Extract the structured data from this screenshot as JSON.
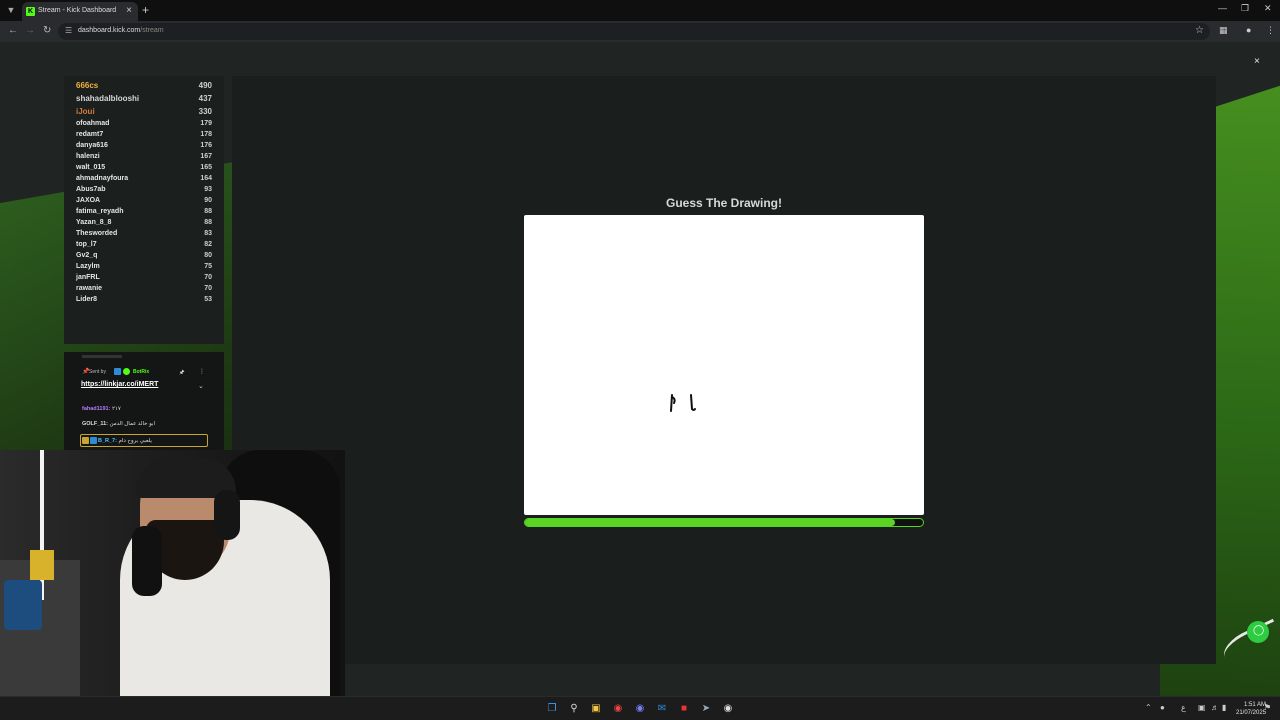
{
  "browser": {
    "tab_title": "Stream - Kick Dashboard",
    "tab_favicon": "K",
    "url_host": "dashboard.kick.com",
    "url_path": "/stream",
    "icons": {
      "tab_menu": "chevron-down-icon",
      "close_tab": "close-icon",
      "new_tab": "plus-icon",
      "back": "arrow-left-icon",
      "forward": "arrow-right-icon",
      "reload": "reload-icon",
      "site_info": "tune-icon",
      "bookmark": "star-icon",
      "extensions": "puzzle-icon",
      "profile": "profile-icon",
      "menu": "kebab-icon"
    }
  },
  "overlay": {
    "close_glyph": "×"
  },
  "leaderboard": [
    {
      "name": "666cs",
      "score": "490",
      "rank": "gold"
    },
    {
      "name": "shahadalblooshi",
      "score": "437",
      "rank": "silver"
    },
    {
      "name": "iJoui",
      "score": "330",
      "rank": "bronze"
    },
    {
      "name": "ofoahmad",
      "score": "179"
    },
    {
      "name": "redamt7",
      "score": "178"
    },
    {
      "name": "danya616",
      "score": "176"
    },
    {
      "name": "halenzi",
      "score": "167"
    },
    {
      "name": "walt_015",
      "score": "165"
    },
    {
      "name": "ahmadnayfoura",
      "score": "164"
    },
    {
      "name": "Abus7ab",
      "score": "93"
    },
    {
      "name": "JAXOA",
      "score": "90"
    },
    {
      "name": "fatima_reyadh",
      "score": "88"
    },
    {
      "name": "Yazan_8_8",
      "score": "88"
    },
    {
      "name": "Thesworded",
      "score": "83"
    },
    {
      "name": "top_l7",
      "score": "82"
    },
    {
      "name": "Gv2_q",
      "score": "80"
    },
    {
      "name": "Lazylm",
      "score": "75"
    },
    {
      "name": "janFRL",
      "score": "70"
    },
    {
      "name": "rawanie",
      "score": "70"
    },
    {
      "name": "Lider8",
      "score": "53"
    }
  ],
  "chat": {
    "pinned": {
      "sent_by_label": "Sent by",
      "bot_name": "BotRix",
      "link": "https://linkjar.co/iMERT"
    },
    "messages": [
      {
        "user": "fahad1191:",
        "text": " ٢١٧",
        "color": "#b57cff"
      },
      {
        "user": "GOLF_11:",
        "text": " ابو خالد عمال الدمن",
        "color": "#e4e4e4"
      },
      {
        "user": "B_R_7:",
        "text": " يلعبي بروح دام",
        "color": "#53c2ff"
      }
    ]
  },
  "game": {
    "title": "Guess The Drawing!",
    "timer_remaining": 0.93
  },
  "taskbar": {
    "apps": [
      "windows-icon",
      "search-icon",
      "file-explorer-icon",
      "chrome-icon",
      "discord-icon",
      "outlook-icon",
      "app-red-icon",
      "steam-icon",
      "obs-icon"
    ],
    "tray_lang": "ع",
    "time": "1:51 AM",
    "date": "21/07/2025"
  },
  "colors": {
    "kick_green": "#53fc18",
    "gold": "#f0b33a",
    "bronze": "#d07b3c"
  }
}
